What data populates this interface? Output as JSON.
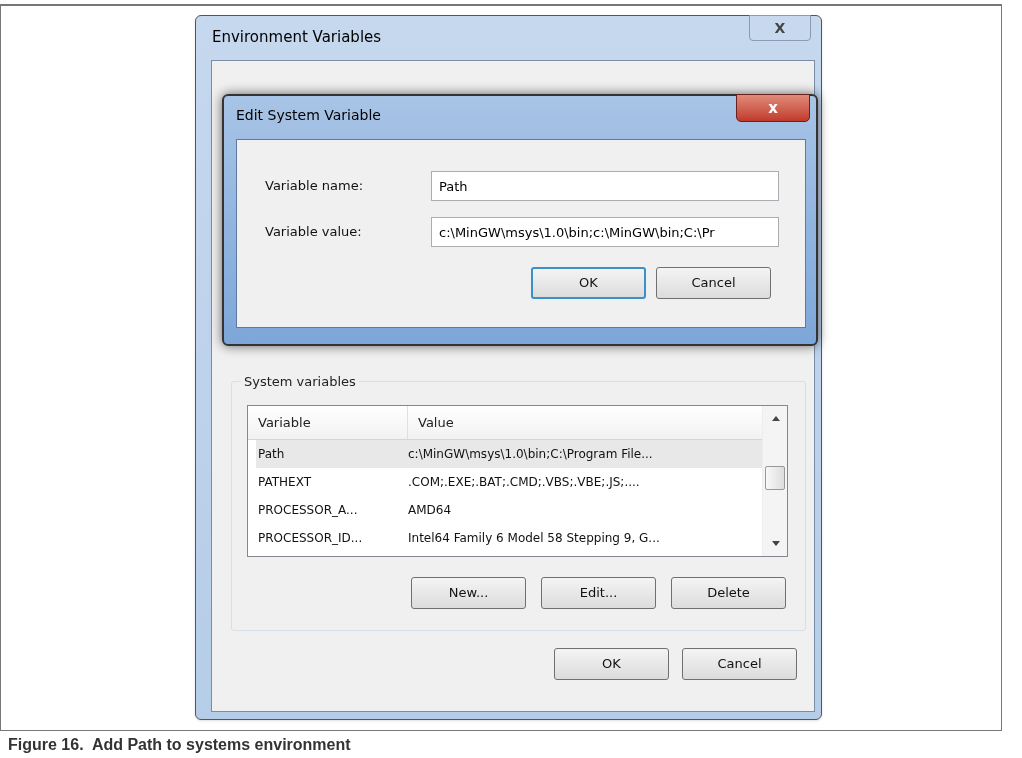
{
  "env_window": {
    "title": "Environment Variables",
    "close": "X"
  },
  "edit_dialog": {
    "title": "Edit System Variable",
    "close": "x",
    "fields": [
      {
        "label": "Variable name:",
        "value": "Path"
      },
      {
        "label": "Variable value:",
        "value": "c:\\MinGW\\msys\\1.0\\bin;c:\\MinGW\\bin;C:\\Pr"
      }
    ],
    "buttons": [
      {
        "label": "OK",
        "default": true
      },
      {
        "label": "Cancel",
        "default": false
      }
    ]
  },
  "system_variables": {
    "legend": "System variables",
    "columns": [
      "Variable",
      "Value"
    ],
    "rows": [
      {
        "cells": [
          "Path",
          "c:\\MinGW\\msys\\1.0\\bin;C:\\Program File..."
        ],
        "selected": true
      },
      {
        "cells": [
          "PATHEXT",
          ".COM;.EXE;.BAT;.CMD;.VBS;.VBE;.JS;...."
        ],
        "selected": false
      },
      {
        "cells": [
          "PROCESSOR_A...",
          "AMD64"
        ],
        "selected": false
      },
      {
        "cells": [
          "PROCESSOR_ID...",
          "Intel64 Family 6 Model 58 Stepping 9, G..."
        ],
        "selected": false
      }
    ],
    "buttons": [
      "New...",
      "Edit...",
      "Delete"
    ]
  },
  "footer_buttons": [
    "OK",
    "Cancel"
  ],
  "caption": "Figure 16.  Add Path to systems environment"
}
